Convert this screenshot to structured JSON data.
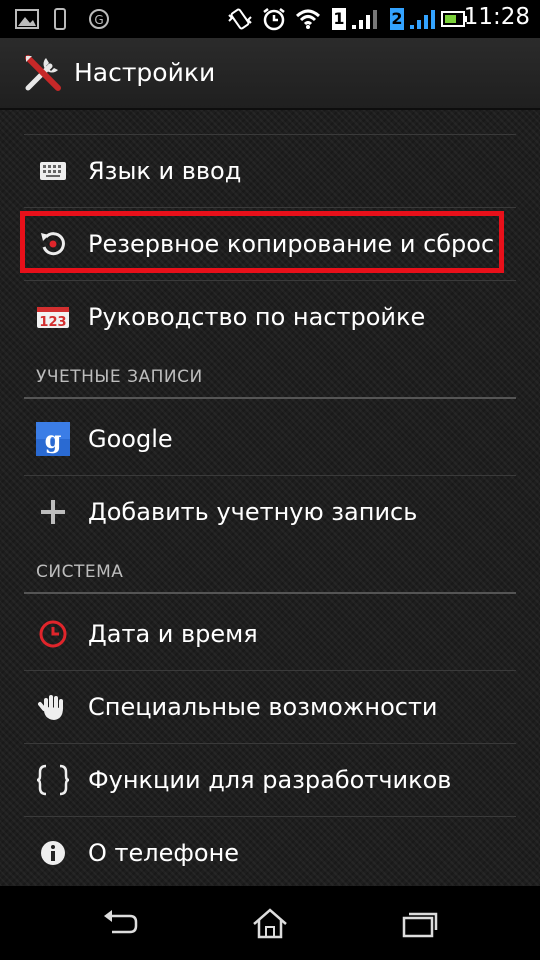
{
  "status_bar": {
    "time": "11:28",
    "sim1": "1",
    "sim2": "2",
    "icons": [
      "image-icon",
      "phone-icon",
      "usb-icon",
      "vibrate-icon",
      "alarm-icon",
      "wifi-icon",
      "sim1-signal-icon",
      "sim2-signal-icon",
      "battery-icon"
    ]
  },
  "action_bar": {
    "title": "Настройки",
    "icon": "tools-icon"
  },
  "items": [
    {
      "label": "Язык и ввод",
      "icon": "keyboard-icon"
    },
    {
      "label": "Резервное копирование и сброс",
      "icon": "backup-reset-icon",
      "highlighted": true
    },
    {
      "label": "Руководство по настройке",
      "icon": "setup-guide-icon"
    }
  ],
  "sections": {
    "accounts": {
      "header": "УЧЕТНЫЕ ЗАПИСИ",
      "items": [
        {
          "label": "Google",
          "icon": "google-icon"
        },
        {
          "label": "Добавить учетную запись",
          "icon": "plus-icon"
        }
      ]
    },
    "system": {
      "header": "СИСТЕМА",
      "items": [
        {
          "label": "Дата и время",
          "icon": "clock-icon"
        },
        {
          "label": "Специальные возможности",
          "icon": "hand-icon"
        },
        {
          "label": "Функции для разработчиков",
          "icon": "braces-icon"
        },
        {
          "label": "О телефоне",
          "icon": "info-icon"
        }
      ]
    }
  },
  "colors": {
    "highlight": "#e8101a",
    "google_blue": "#2a6ad2",
    "clock_red": "#e0252b"
  },
  "nav_bar": [
    "back-icon",
    "home-icon",
    "recents-icon"
  ]
}
